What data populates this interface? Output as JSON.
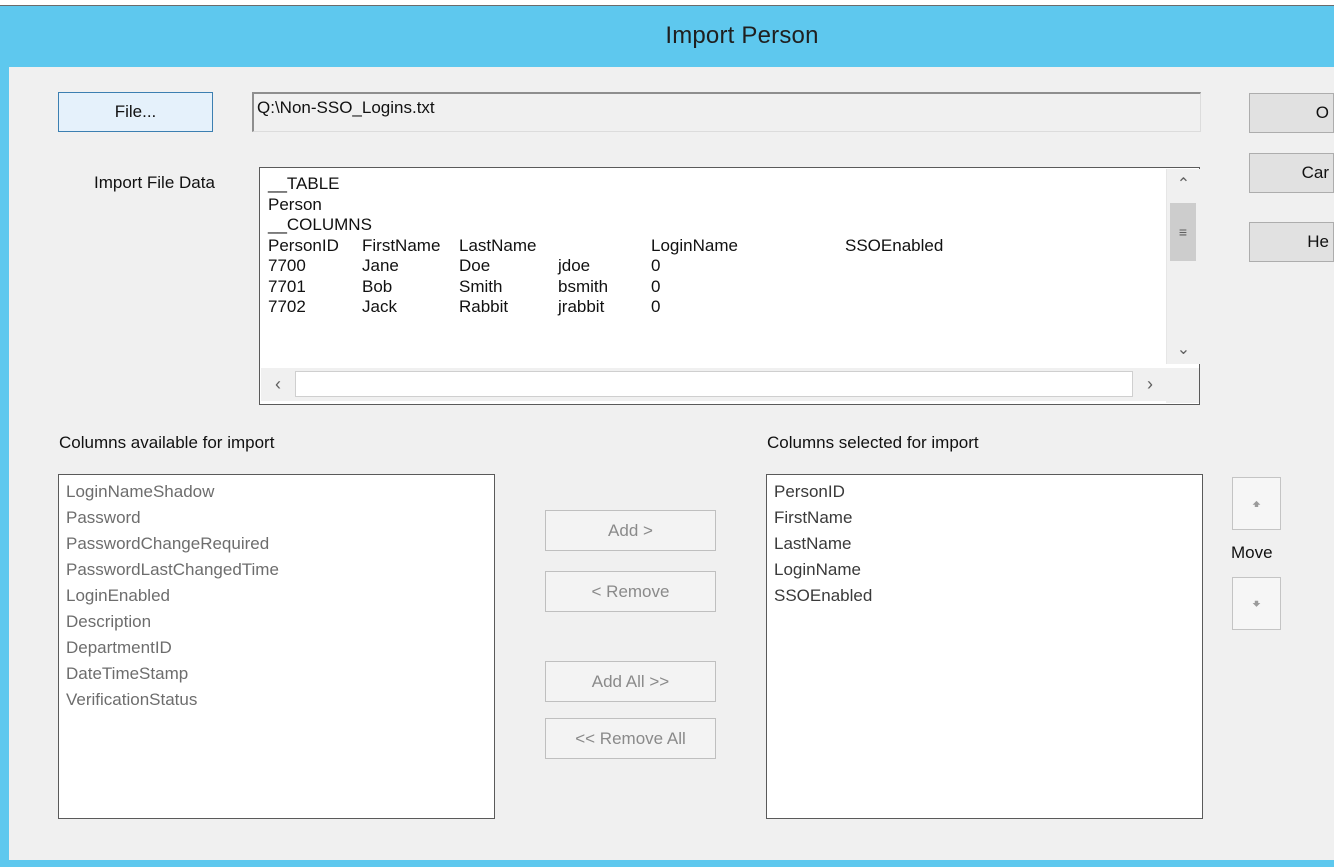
{
  "window": {
    "title": "Import  Person"
  },
  "file": {
    "button_label": "File...",
    "path": "Q:\\Non-SSO_Logins.txt"
  },
  "side_buttons": {
    "ok_label": "O",
    "cancel_label": "Car",
    "help_label": "He"
  },
  "import_data": {
    "label": "Import File Data",
    "lines": [
      "__TABLE",
      "Person",
      "__COLUMNS"
    ],
    "header": [
      "PersonID",
      "FirstName",
      "LastName",
      "LoginName",
      "SSOEnabled"
    ],
    "rows": [
      [
        "7700",
        "Jane",
        "Doe",
        "jdoe",
        "0"
      ],
      [
        "7701",
        "Bob",
        "Smith",
        "bsmith",
        "0"
      ],
      [
        "7702",
        "Jack",
        "Rabbit",
        "jrabbit",
        "0"
      ]
    ]
  },
  "available": {
    "label": "Columns available for import",
    "items": [
      "LoginNameShadow",
      "Password",
      "PasswordChangeRequired",
      "PasswordLastChangedTime",
      "LoginEnabled",
      "Description",
      "DepartmentID",
      "DateTimeStamp",
      "VerificationStatus"
    ]
  },
  "selected": {
    "label": "Columns selected for import",
    "items": [
      "PersonID",
      "FirstName",
      "LastName",
      "LoginName",
      "SSOEnabled"
    ]
  },
  "transfer": {
    "add_label": "Add >",
    "remove_label": "< Remove",
    "add_all_label": "Add All >>",
    "remove_all_label": "<< Remove All"
  },
  "move": {
    "label": "Move",
    "up_icon": "arrow-up-icon",
    "down_icon": "arrow-down-icon"
  },
  "colors": {
    "title_bar": "#5ec8ee",
    "dialog_background": "#f0f0f0",
    "default_button_border": "#3c7fb1"
  }
}
